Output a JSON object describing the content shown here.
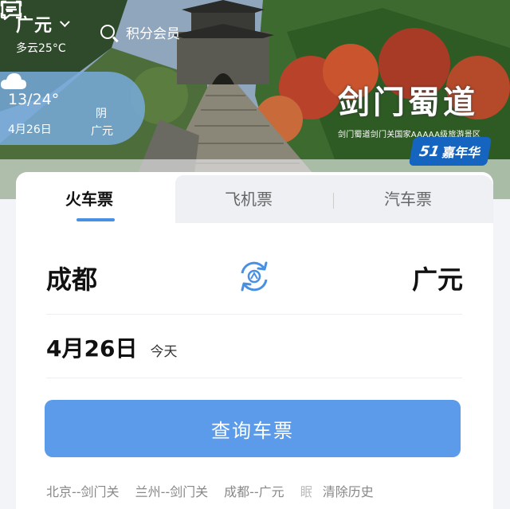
{
  "location": {
    "city": "广元",
    "weather": "多云25°C"
  },
  "search": {
    "placeholder": "积分会员"
  },
  "weather_card": {
    "temp_range": "13/24°",
    "date": "4月26日",
    "condition": "阴",
    "city": "广元"
  },
  "banner": {
    "title": "剑门蜀道",
    "subtitle": "剑门蜀道剑门关国家AAAAA级旅游景区",
    "badge_num": "51",
    "badge_text": "嘉年华"
  },
  "tabs": [
    {
      "label": "火车票",
      "active": true
    },
    {
      "label": "飞机票",
      "active": false
    },
    {
      "label": "汽车票",
      "active": false
    }
  ],
  "route": {
    "from": "成都",
    "to": "广元"
  },
  "date": {
    "value": "4月26日",
    "relative": "今天"
  },
  "query_button": "查询车票",
  "history": {
    "items": [
      "北京--剑门关",
      "兰州--剑门关",
      "成都--广元"
    ],
    "clipped": "眠",
    "clear": "清除历史"
  },
  "colors": {
    "accent": "#5b9bea",
    "tab_underline": "#4a90e2",
    "badge": "#1565c0"
  },
  "icons": [
    "chevron-down-icon",
    "search-icon",
    "scan-icon",
    "message-icon",
    "cloud-icon",
    "swap-stations-icon"
  ]
}
